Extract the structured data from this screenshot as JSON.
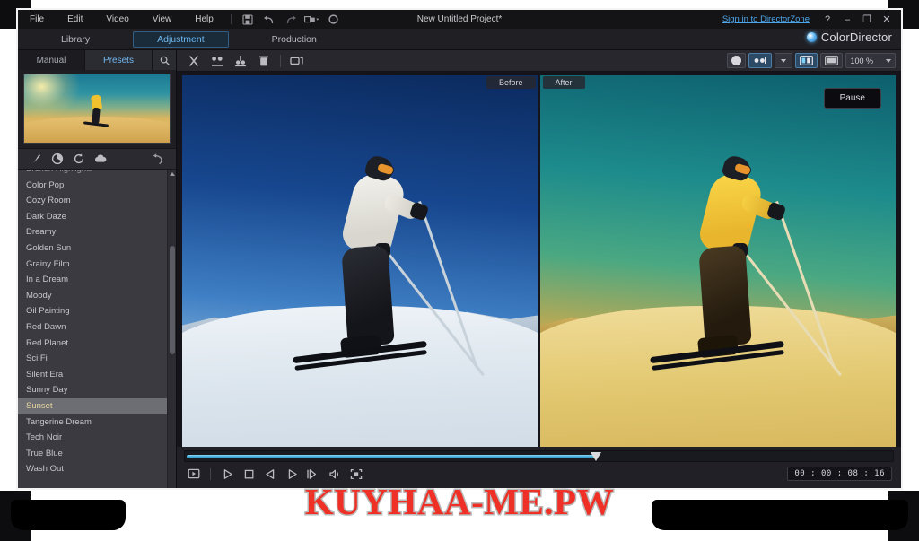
{
  "window": {
    "project_title": "New Untitled Project*",
    "signin_label": "Sign in to DirectorZone",
    "help_label": "?",
    "minimize_label": "–",
    "restore_label": "❐",
    "close_label": "✕",
    "brand_name": "ColorDirector"
  },
  "menubar": {
    "items": [
      {
        "label": "File"
      },
      {
        "label": "Edit"
      },
      {
        "label": "Video"
      },
      {
        "label": "View"
      },
      {
        "label": "Help"
      }
    ],
    "icons": [
      "snapshot-icon",
      "undo-icon",
      "redo-icon",
      "aspect-ratio-icon",
      "settings-gear-icon"
    ]
  },
  "mode_tabs": [
    {
      "label": "Library",
      "active": false
    },
    {
      "label": "Adjustment",
      "active": true
    },
    {
      "label": "Production",
      "active": false
    }
  ],
  "left_panel": {
    "tabs": [
      {
        "label": "Manual",
        "active": false
      },
      {
        "label": "Presets",
        "active": true
      }
    ],
    "search_icon": "search-icon",
    "icon_row": [
      "brush-icon",
      "color-wheel-icon",
      "reset-icon",
      "cloud-download-icon"
    ],
    "undo_icon": "undo-arrow-icon",
    "presets": [
      {
        "label": "Broken Highlights",
        "selected": false,
        "clipped": true
      },
      {
        "label": "Color Pop",
        "selected": false
      },
      {
        "label": "Cozy Room",
        "selected": false
      },
      {
        "label": "Dark Daze",
        "selected": false
      },
      {
        "label": "Dreamy",
        "selected": false
      },
      {
        "label": "Golden Sun",
        "selected": false
      },
      {
        "label": "Grainy Film",
        "selected": false
      },
      {
        "label": "In a Dream",
        "selected": false
      },
      {
        "label": "Moody",
        "selected": false
      },
      {
        "label": "Oil Painting",
        "selected": false
      },
      {
        "label": "Red Dawn",
        "selected": false
      },
      {
        "label": "Red Planet",
        "selected": false
      },
      {
        "label": "Sci Fi",
        "selected": false
      },
      {
        "label": "Silent Era",
        "selected": false
      },
      {
        "label": "Sunny Day",
        "selected": false
      },
      {
        "label": "Sunset",
        "selected": true
      },
      {
        "label": "Tangerine Dream",
        "selected": false
      },
      {
        "label": "Tech Noir",
        "selected": false
      },
      {
        "label": "True Blue",
        "selected": false
      },
      {
        "label": "Wash Out",
        "selected": false
      }
    ]
  },
  "main_toolbar": {
    "left_icons": [
      "split-clip-icon",
      "keyframe-icon",
      "trim-icon",
      "delete-trash-icon",
      "duplicate-icon"
    ],
    "right": {
      "color_circle_icon": "color-circle-icon",
      "compare_mode_icon": "split-compare-icon",
      "compare_caret_icon": "chevron-down-icon",
      "view-single_icon": "single-view-icon",
      "view-split_icon": "split-view-icon",
      "zoom_value": "100 %",
      "zoom_caret_icon": "chevron-down-icon"
    }
  },
  "preview": {
    "label_before": "Before",
    "label_after": "After",
    "pause_button": "Pause"
  },
  "transport": {
    "seek_percent": 58,
    "controls": [
      "capture-frame-icon",
      "play-icon",
      "stop-icon",
      "previous-frame-icon",
      "next-frame-icon",
      "fast-forward-icon",
      "volume-icon",
      "fullscreen-icon"
    ],
    "timecode": "00 ; 00 ; 08 ; 16"
  },
  "watermark": {
    "text": "KUYHAA-ME.PW"
  },
  "colors": {
    "accent_blue": "#6fb7ee",
    "link_blue": "#4ea6e8",
    "selection_gray": "#6d6d74",
    "watermark_red": "#ef3026",
    "watermark_outline": "#b9b9b9",
    "seek_cyan": "#3fa8d8"
  }
}
